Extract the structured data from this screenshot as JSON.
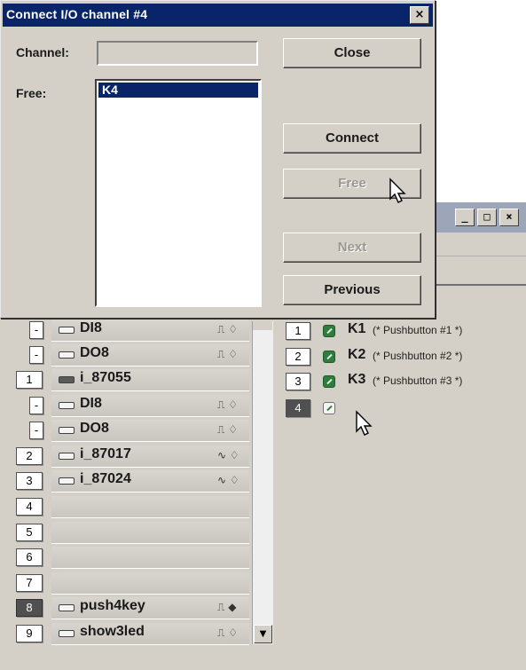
{
  "dialog": {
    "title": "Connect I/O channel #4",
    "close_glyph": "×",
    "channel_label": "Channel:",
    "channel_value": "",
    "free_label": "Free:",
    "free_items": [
      "K4"
    ],
    "buttons": {
      "close": "Close",
      "connect": "Connect",
      "free": "Free",
      "next": "Next",
      "previous": "Previous"
    }
  },
  "window_controls": {
    "minimize": "_",
    "maximize": "□",
    "close": "×"
  },
  "device_list": [
    {
      "num": "-",
      "name": "DI8",
      "sig": "⎍ ♢",
      "icon": "connector-icon"
    },
    {
      "num": "-",
      "name": "DO8",
      "sig": "⎍ ♢",
      "icon": "connector-icon"
    },
    {
      "num": "1",
      "name": "i_87055",
      "sig": "",
      "icon": "module-icon"
    },
    {
      "num": "-",
      "name": "DI8",
      "sig": "⎍ ♢",
      "icon": "connector-icon"
    },
    {
      "num": "-",
      "name": "DO8",
      "sig": "⎍ ♢",
      "icon": "connector-icon"
    },
    {
      "num": "2",
      "name": "i_87017",
      "sig": "∿ ♢",
      "icon": "connector-icon"
    },
    {
      "num": "3",
      "name": "i_87024",
      "sig": "∿ ♢",
      "icon": "connector-icon"
    },
    {
      "num": "4",
      "name": "",
      "sig": ""
    },
    {
      "num": "5",
      "name": "",
      "sig": ""
    },
    {
      "num": "6",
      "name": "",
      "sig": ""
    },
    {
      "num": "7",
      "name": "",
      "sig": ""
    },
    {
      "num": "8",
      "name": "push4key",
      "sig": "⎍ ◆",
      "icon": "connector-icon"
    },
    {
      "num": "9",
      "name": "show3led",
      "sig": "⎍ ♢",
      "icon": "connector-icon"
    }
  ],
  "scroll_down_glyph": "▼",
  "key_list": [
    {
      "num": "1",
      "name": "K1",
      "desc": "(* Pushbutton #1 *)"
    },
    {
      "num": "2",
      "name": "K2",
      "desc": "(* Pushbutton #2 *)"
    },
    {
      "num": "3",
      "name": "K3",
      "desc": "(* Pushbutton #3 *)"
    },
    {
      "num": "4",
      "name": "",
      "desc": ""
    }
  ]
}
